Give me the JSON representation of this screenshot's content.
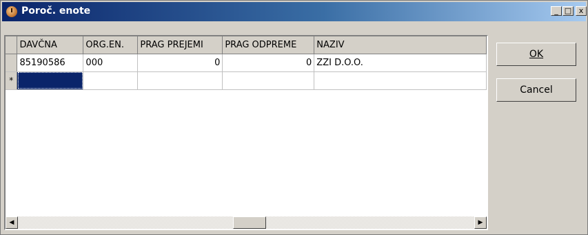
{
  "window": {
    "title": "Poroč. enote",
    "min": "_",
    "max": "□",
    "close": "x"
  },
  "grid": {
    "columns": [
      "DAVČNA",
      "ORG.EN.",
      "PRAG PREJEMI",
      "PRAG ODPREME",
      "NAZIV"
    ],
    "rows": [
      [
        "85190586",
        "000",
        "0",
        "0",
        "ZZI D.O.O."
      ]
    ],
    "new_row_marker": "*"
  },
  "buttons": {
    "ok": "OK",
    "cancel": "Cancel"
  },
  "scroll": {
    "left": "◀",
    "right": "▶"
  }
}
